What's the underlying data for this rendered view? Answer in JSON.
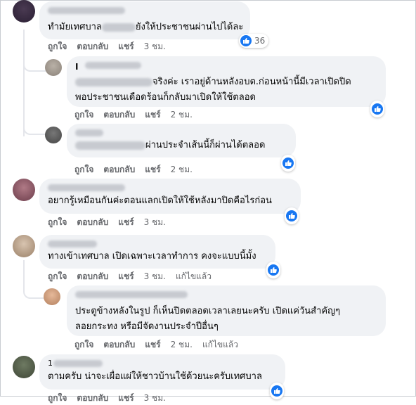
{
  "actions": {
    "like": "ถูกใจ",
    "reply": "ตอบกลับ",
    "share": "แชร์",
    "edited": "แก้ไขแล้ว"
  },
  "colors": {
    "bubble": "#f0f2f5",
    "like_blue": "#1877f2",
    "meta_gray": "#65676b"
  },
  "comments": [
    {
      "text_before": "ทำมัยเทศบาล",
      "text_after": "ยังให้ประชาชนผ่านไปได้ละ",
      "time": "3 ชม.",
      "reaction_count": "36"
    },
    {
      "marker": "I",
      "line1": "จริงค่ะ เราอยู่ด้านหลังอบต.ก่อนหน้านี้มีเวลาเปิดปิด",
      "line2": "พอประชาชนเดือดร้อนก็กลับมาเปิดให้ใช้ตลอด",
      "time": "2 ชม."
    },
    {
      "text": "ผ่านประจำเส้นนี้ก็ผ่านได้ตลอด",
      "time": "2 ชม."
    },
    {
      "text": "อยากรู้เหมือนกันค่ะตอนแลกเปิดให้ใช้หลังมาปิดคือไรก่อน",
      "time": "3 ชม."
    },
    {
      "text": "ทางเข้าเทศบาล เปิดเฉพาะเวลาทำการ คงจะแบบนี้มั้ง",
      "time": "3 ชม."
    },
    {
      "line1": "ประตูข้างหลังในรูป ก็เห็นปิดตลอดเวลาเลยนะครับ เปิดแค่วันสำคัญๆ",
      "line2": "ลอยกระทง หรือมีจัดงานประจำปีอื่นๆ",
      "time": "2 ชม."
    },
    {
      "marker": "1",
      "text": "ตามครับ น่าจะเผื่อแผ่ให้ชาวบ้านใช้ด้วยนะครับเทศบาล",
      "time": "3 ชม."
    }
  ]
}
